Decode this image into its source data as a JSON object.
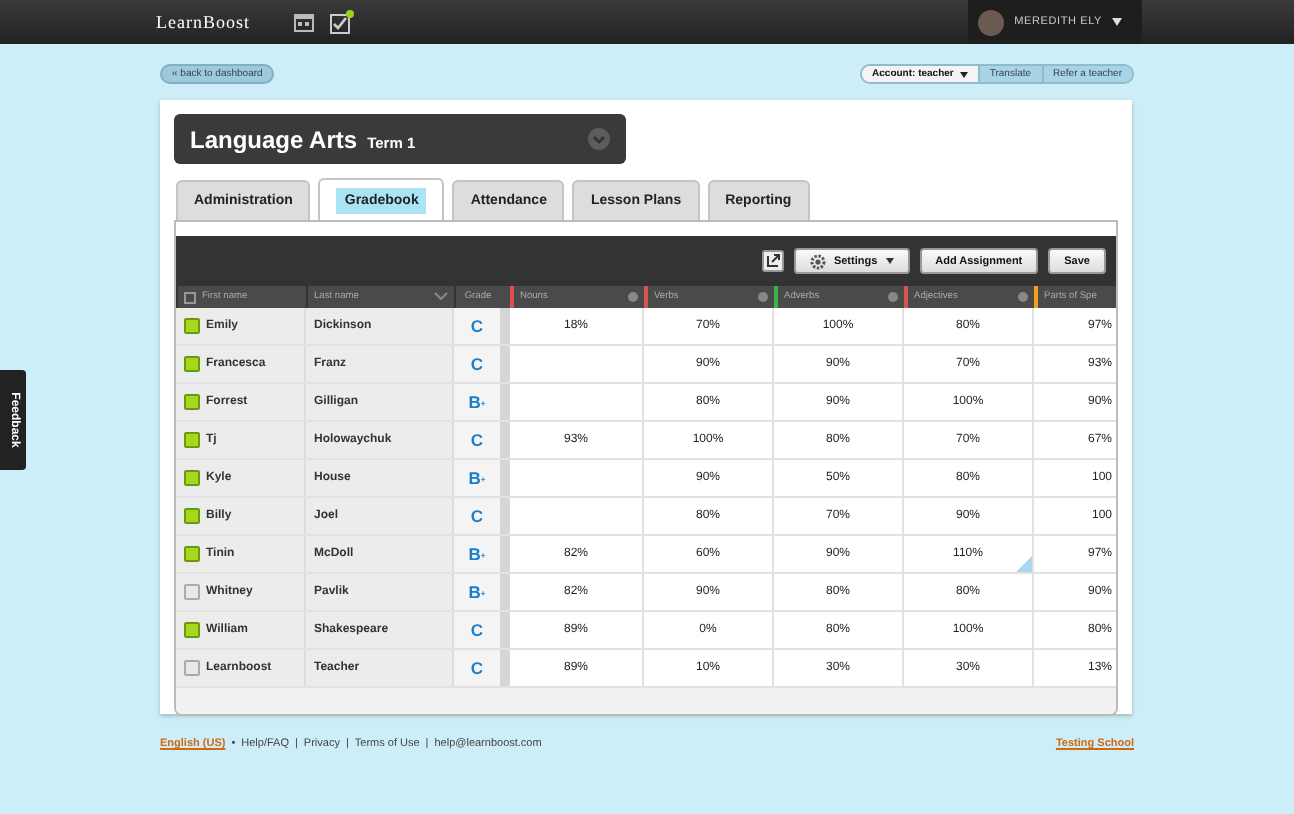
{
  "topbar": {
    "logo": "LearnBoost",
    "user": "MEREDITH ELY"
  },
  "subnav": {
    "back": "« back to dashboard",
    "account": "Account: teacher",
    "links": [
      "Translate",
      "Refer a teacher"
    ]
  },
  "course": {
    "title": "Language Arts",
    "term": "Term 1"
  },
  "tabs": [
    {
      "label": "Administration",
      "selected": false
    },
    {
      "label": "Gradebook",
      "selected": true
    },
    {
      "label": "Attendance",
      "selected": false
    },
    {
      "label": "Lesson Plans",
      "selected": false
    },
    {
      "label": "Reporting",
      "selected": false
    }
  ],
  "toolbar": {
    "buttons": [
      {
        "kind": "settings",
        "label": "Settings"
      },
      {
        "kind": "plain",
        "label": "Add Assignment"
      },
      {
        "kind": "plain",
        "label": "Save"
      }
    ]
  },
  "columns": {
    "student": [
      "First name",
      "Last name",
      "Grade"
    ],
    "assignments": [
      {
        "label": "Nouns",
        "color": "#d9534f"
      },
      {
        "label": "Verbs",
        "color": "#d9534f"
      },
      {
        "label": "Adverbs",
        "color": "#3cb44b"
      },
      {
        "label": "Adjectives",
        "color": "#d9534f"
      },
      {
        "label": "Parts of Spe",
        "color": "#f0a020"
      }
    ]
  },
  "rows": [
    {
      "checked": true,
      "first": "Emily",
      "last": "Dickinson",
      "grade": "C",
      "nouns": "18%",
      "verbs": "70%",
      "adverbs": "100%",
      "adjectives": "80%",
      "parts_of_speech": "97%"
    },
    {
      "checked": true,
      "first": "Francesca",
      "last": "Franz",
      "grade": "C",
      "verbs": "90%",
      "adverbs": "90%",
      "adjectives": "70%",
      "parts_of_speech": "93%"
    },
    {
      "checked": true,
      "first": "Forrest",
      "last": "Gilligan",
      "grade": "B$^{+}$",
      "verbs": "80%",
      "adverbs": "90%",
      "adjectives": "100%",
      "parts_of_speech": "90%"
    },
    {
      "checked": true,
      "first": "Tj",
      "last": "Holowaychuk",
      "grade": "C",
      "nouns": "93%",
      "verbs": "100%",
      "adverbs": "80%",
      "adjectives": "70%",
      "parts_of_speech": "67%"
    },
    {
      "checked": true,
      "first": "Kyle",
      "last": "House",
      "grade": "B$^{+}$",
      "verbs": "90%",
      "adverbs": "50%",
      "adjectives": "80%",
      "parts_of_speech": "100"
    },
    {
      "checked": true,
      "first": "Billy",
      "last": "Joel",
      "grade": "C",
      "verbs": "80%",
      "adverbs": "70%",
      "adjectives": "90%",
      "parts_of_speech": "100"
    },
    {
      "checked": true,
      "first": "Tinin",
      "last": "McDoll",
      "grade": "B$^{+}$",
      "nouns": "82%",
      "verbs": "60%",
      "adverbs": "90%",
      "adjectives": "110%",
      "parts_of_speech": "97%"
    },
    {
      "checked": false,
      "first": "Whitney",
      "last": "Pavlik",
      "grade": "B$^{+}$",
      "nouns": "82%",
      "verbs": "90%",
      "adverbs": "80%",
      "adjectives": "80%",
      "parts_of_speech": "90%"
    },
    {
      "checked": true,
      "first": "William",
      "last": "Shakespeare",
      "grade": "C",
      "nouns": "89%",
      "verbs": "0%",
      "adverbs": "80%",
      "adjectives": "100%",
      "parts_of_speech": "80%"
    },
    {
      "checked": false,
      "first": "Learnboost",
      "last": "Teacher",
      "grade": "C",
      "nouns": "89%",
      "verbs": "10%",
      "adverbs": "30%",
      "adjectives": "30%",
      "parts_of_speech": "13%"
    }
  ],
  "feedback": "Feedback",
  "footer": {
    "items": [
      {
        "kind": "link",
        "text": "English (US)"
      },
      {
        "kind": "separator",
        "text": "•"
      },
      {
        "kind": "plain",
        "text": "Help/FAQ"
      },
      {
        "kind": "separator",
        "text": "|"
      },
      {
        "kind": "plain",
        "text": "Privacy"
      },
      {
        "kind": "separator",
        "text": "|"
      },
      {
        "kind": "plain",
        "text": "Terms of Use"
      },
      {
        "kind": "separator",
        "text": "|"
      },
      {
        "kind": "plain",
        "text": "help@learnboost.com"
      }
    ],
    "school": "Testing School"
  }
}
